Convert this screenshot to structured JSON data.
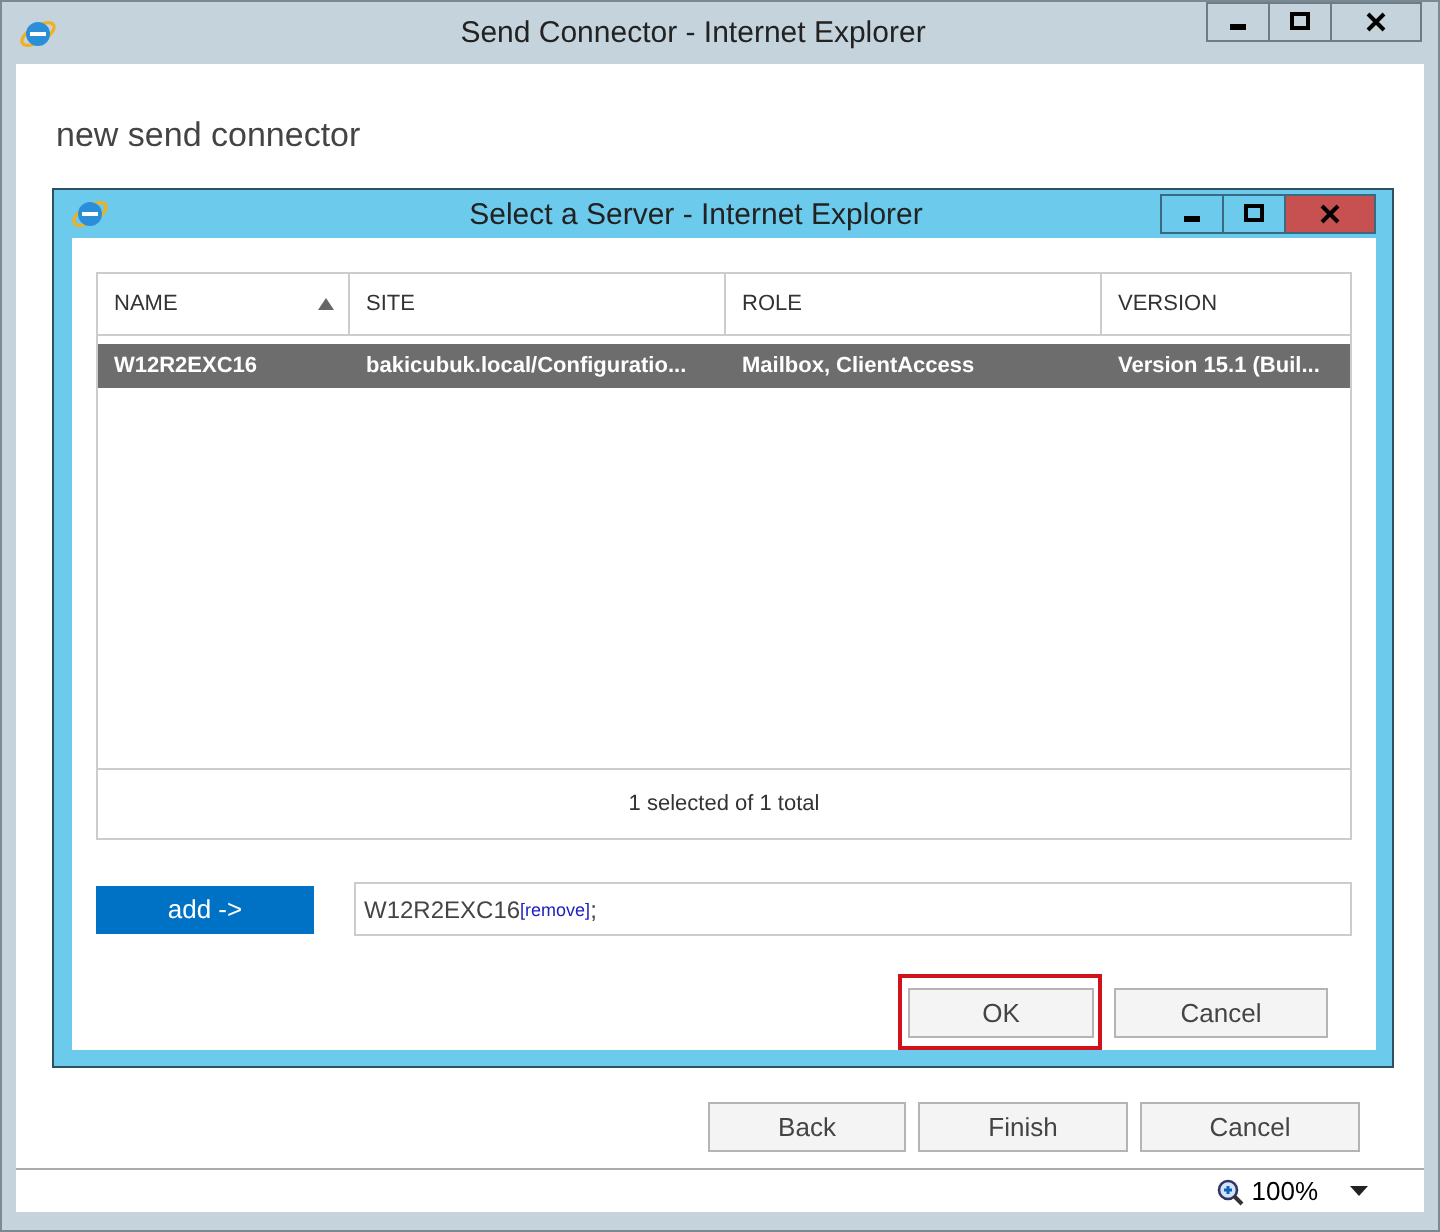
{
  "window": {
    "title": "Send Connector - Internet Explorer"
  },
  "page": {
    "heading": "new send connector"
  },
  "dialog": {
    "title": "Select a Server - Internet Explorer",
    "table": {
      "columns": [
        {
          "label": "NAME",
          "sorted": true
        },
        {
          "label": "SITE",
          "sorted": false
        },
        {
          "label": "ROLE",
          "sorted": false
        },
        {
          "label": "VERSION",
          "sorted": false
        }
      ],
      "rows": [
        {
          "cells": [
            "W12R2EXC16",
            "bakicubuk.local/Configuratio...",
            "Mailbox, ClientAccess",
            "Version 15.1 (Buil..."
          ],
          "selected": true
        }
      ],
      "footer": "1 selected of 1 total"
    },
    "add_button": "add ->",
    "selection": {
      "value": "W12R2EXC16",
      "remove_link": "[remove]",
      "separator": ";"
    },
    "buttons": [
      {
        "label": "OK",
        "highlighted": true
      },
      {
        "label": "Cancel",
        "highlighted": false
      }
    ]
  },
  "wizard_buttons": [
    "Back",
    "Finish",
    "Cancel"
  ],
  "status_bar": {
    "zoom": "100%"
  }
}
